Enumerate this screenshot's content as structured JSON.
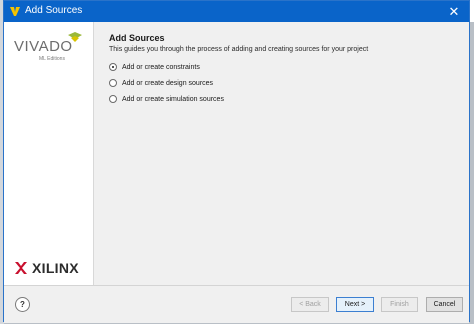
{
  "window": {
    "title": "Add Sources"
  },
  "brand": {
    "vivado": "VIVADO",
    "vivado_sub": "ML Editions",
    "xilinx": "XILINX"
  },
  "page": {
    "heading": "Add Sources",
    "description": "This guides you through the process of adding and creating sources for your project"
  },
  "options": [
    {
      "label": "Add or create constraints",
      "selected": true
    },
    {
      "label": "Add or create design sources",
      "selected": false
    },
    {
      "label": "Add or create simulation sources",
      "selected": false
    }
  ],
  "footer": {
    "help": "?",
    "back": "< Back",
    "next": "Next >",
    "finish": "Finish",
    "cancel": "Cancel"
  },
  "colors": {
    "titlebar": "#0a64c9",
    "accent": "#3c7fd1"
  }
}
